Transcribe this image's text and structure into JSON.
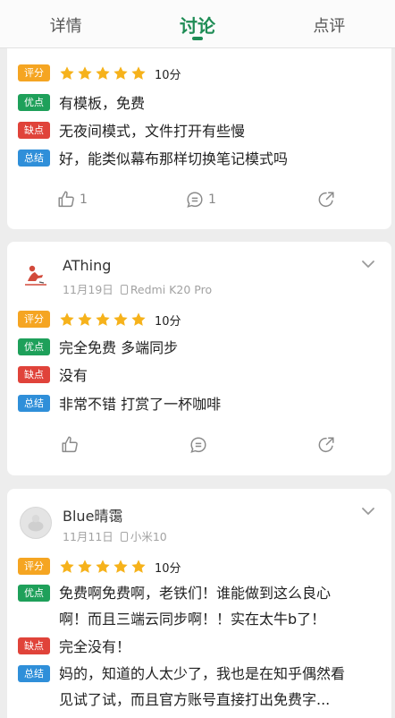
{
  "tabs": [
    "详情",
    "讨论",
    "点评"
  ],
  "active_tab": "讨论",
  "colors": {
    "accent": "#1e8c55",
    "rating_tag": "#f5a522",
    "pros_tag": "#1ea05a",
    "cons_tag": "#e0433a",
    "summary_tag": "#2f8fd9",
    "star": "#f6b21b"
  },
  "labels": {
    "rating": "评分",
    "pros": "优点",
    "cons": "缺点",
    "summary": "总结"
  },
  "reviews": [
    {
      "score": "10分",
      "stars": 5,
      "pros": "有模板，免费",
      "cons": "无夜间模式，文件打开有些慢",
      "summary": "好，能类似幕布那样切换笔记模式吗",
      "likes": "1",
      "comments": "1"
    },
    {
      "user": "AThing",
      "date": "11月19日",
      "device": "Redmi K20 Pro",
      "score": "10分",
      "stars": 5,
      "pros": "完全免费 多端同步",
      "cons": "没有",
      "summary": "非常不错 打赏了一杯咖啡",
      "likes": "",
      "comments": ""
    },
    {
      "user": "Blue晴霭",
      "date": "11月11日",
      "device": "小米10",
      "score": "10分",
      "stars": 5,
      "pros_line1": "免费啊免费啊，老铁们！谁能做到这么良心",
      "pros_line2": "啊！而且三端云同步啊！！实在太牛b了！",
      "cons": "完全没有！",
      "summary_line1": "妈的，知道的人太少了，我也是在知乎偶然看",
      "summary_line2": "见试了试，而且官方账号直接打出免费字..."
    }
  ],
  "icons": [
    "like-icon",
    "comment-icon",
    "share-icon",
    "chevron-down-icon",
    "phone-icon",
    "star-icon"
  ]
}
